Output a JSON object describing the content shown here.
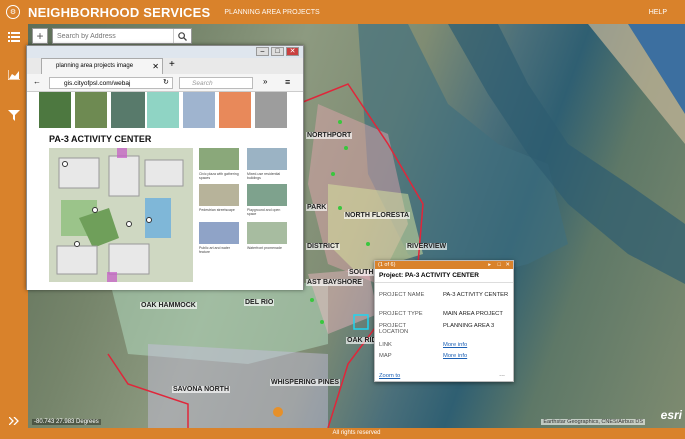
{
  "header": {
    "title": "NEIGHBORHOOD SERVICES",
    "subtitle": "PLANNING AREA PROJECTS",
    "help": "HELP"
  },
  "sidebar": {
    "items": [
      {
        "name": "list-icon"
      },
      {
        "name": "chart-icon"
      },
      {
        "name": "filter-icon"
      },
      {
        "name": "expand-icon"
      }
    ]
  },
  "map": {
    "search_placeholder": "Search by Address",
    "zoom_in": "+",
    "scale_text": "-80.743 27.983 Degrees",
    "attribution": "Earthstar Geographics, CNES/Airbus DS",
    "esri": "esri",
    "region_labels": [
      "NORTHPORT",
      "PARK",
      "NORTH FLORESTA",
      "DISTRICT",
      "RIVERVIEW",
      "SOUTH",
      "AST BAYSHORE",
      "OAK HAMMOCK",
      "DEL RIO",
      "OAK RID",
      "SAVONA NORTH",
      "WHISPERING PINES"
    ]
  },
  "browser": {
    "tab_title": "planning area projects image",
    "url": "gis.cityofpsl.com/webaj",
    "search_placeholder": "Search",
    "page_title": "PA-3 ACTIVITY CENTER",
    "swatch_colors": [
      "#8fd4c4",
      "#9fb4cf",
      "#e8895a",
      "#9d9d9d"
    ],
    "thumb_captions": [
      "Civic plaza with gathering spaces",
      "Mixed-use residential buildings",
      "Pedestrian streetscape",
      "Playground and open space",
      "Public art and water feature",
      "Waterfront promenade"
    ]
  },
  "popup": {
    "counter": "(1 of 6)",
    "title": "Project: PA-3 ACTIVITY CENTER",
    "fields": [
      {
        "label": "PROJECT NAME",
        "value": "PA-3 ACTIVITY CENTER"
      },
      {
        "label": "PROJECT TYPE",
        "value": "MAIN AREA PROJECT"
      },
      {
        "label": "PROJECT LOCATION",
        "value": "PLANNING AREA 3"
      },
      {
        "label": "LINK",
        "value": "More info"
      },
      {
        "label": "MAP",
        "value": "More info"
      }
    ],
    "zoom_to": "Zoom to",
    "more": "..."
  },
  "footer": {
    "text": "All rights reserved"
  }
}
